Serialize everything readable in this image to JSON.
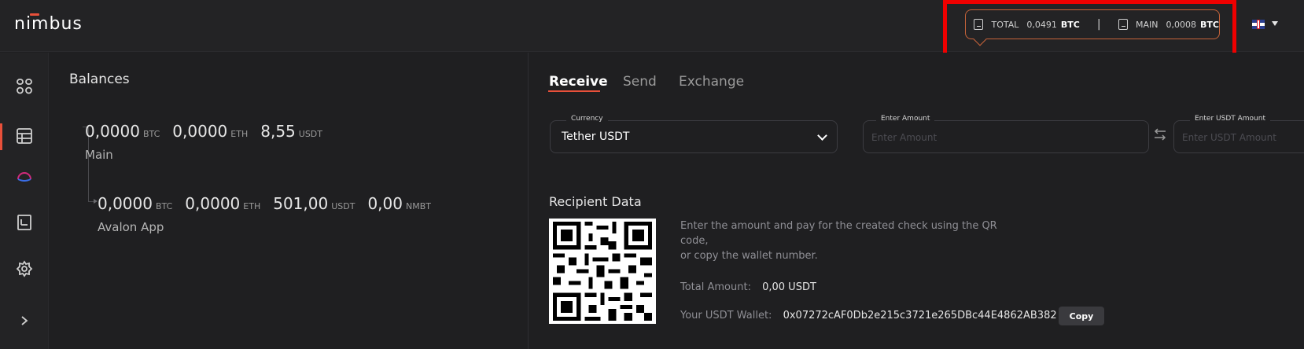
{
  "app": {
    "logo_text": "nimbus"
  },
  "header": {
    "total_label": "TOTAL",
    "total_amount": "0,0491",
    "total_unit": "BTC",
    "separator": "|",
    "main_label": "MAIN",
    "main_amount": "0,0008",
    "main_unit": "BTC",
    "language_flag": "uk-flag-icon"
  },
  "sidebar": {
    "items": [
      {
        "icon": "dashboard-icon"
      },
      {
        "icon": "table-icon",
        "active": true
      },
      {
        "icon": "avalon-icon"
      },
      {
        "icon": "ledger-icon"
      },
      {
        "icon": "gear-icon"
      },
      {
        "icon": "chevron-right-icon"
      }
    ]
  },
  "balances": {
    "title": "Balances",
    "main": {
      "name": "Main",
      "amounts": [
        {
          "value": "0,0000",
          "unit": "BTC"
        },
        {
          "value": "0,0000",
          "unit": "ETH"
        },
        {
          "value": "8,55",
          "unit": "USDT"
        }
      ]
    },
    "avalon": {
      "name": "Avalon App",
      "amounts": [
        {
          "value": "0,0000",
          "unit": "BTC"
        },
        {
          "value": "0,0000",
          "unit": "ETH"
        },
        {
          "value": "501,00",
          "unit": "USDT"
        },
        {
          "value": "0,00",
          "unit": "NMBT"
        }
      ]
    }
  },
  "tabs": [
    {
      "label": "Receive",
      "active": true
    },
    {
      "label": "Send",
      "active": false
    },
    {
      "label": "Exchange",
      "active": false
    }
  ],
  "form": {
    "currency_label": "Currency",
    "currency_value": "Tether USDT",
    "amount_label": "Enter Amount",
    "amount_placeholder": "Enter  Amount",
    "usdt_amount_label": "Enter USDT Amount",
    "usdt_amount_placeholder": "Enter USDT Amount"
  },
  "recipient": {
    "title": "Recipient Data",
    "info_line1": "Enter the amount and pay for the created check using the QR code,",
    "info_line2": "or copy the wallet number.",
    "total_label": "Total Amount:",
    "total_value": "0,00 USDT",
    "wallet_label": "Your USDT Wallet:",
    "wallet_value": "0x07272cAF0Db2e215c3721e265DBc44E4862AB382",
    "copy_label": "Copy"
  },
  "colors": {
    "accent": "#e8503a",
    "highlight_box": "#ef0000",
    "background": "#1f1f21",
    "panel": "#232325"
  }
}
